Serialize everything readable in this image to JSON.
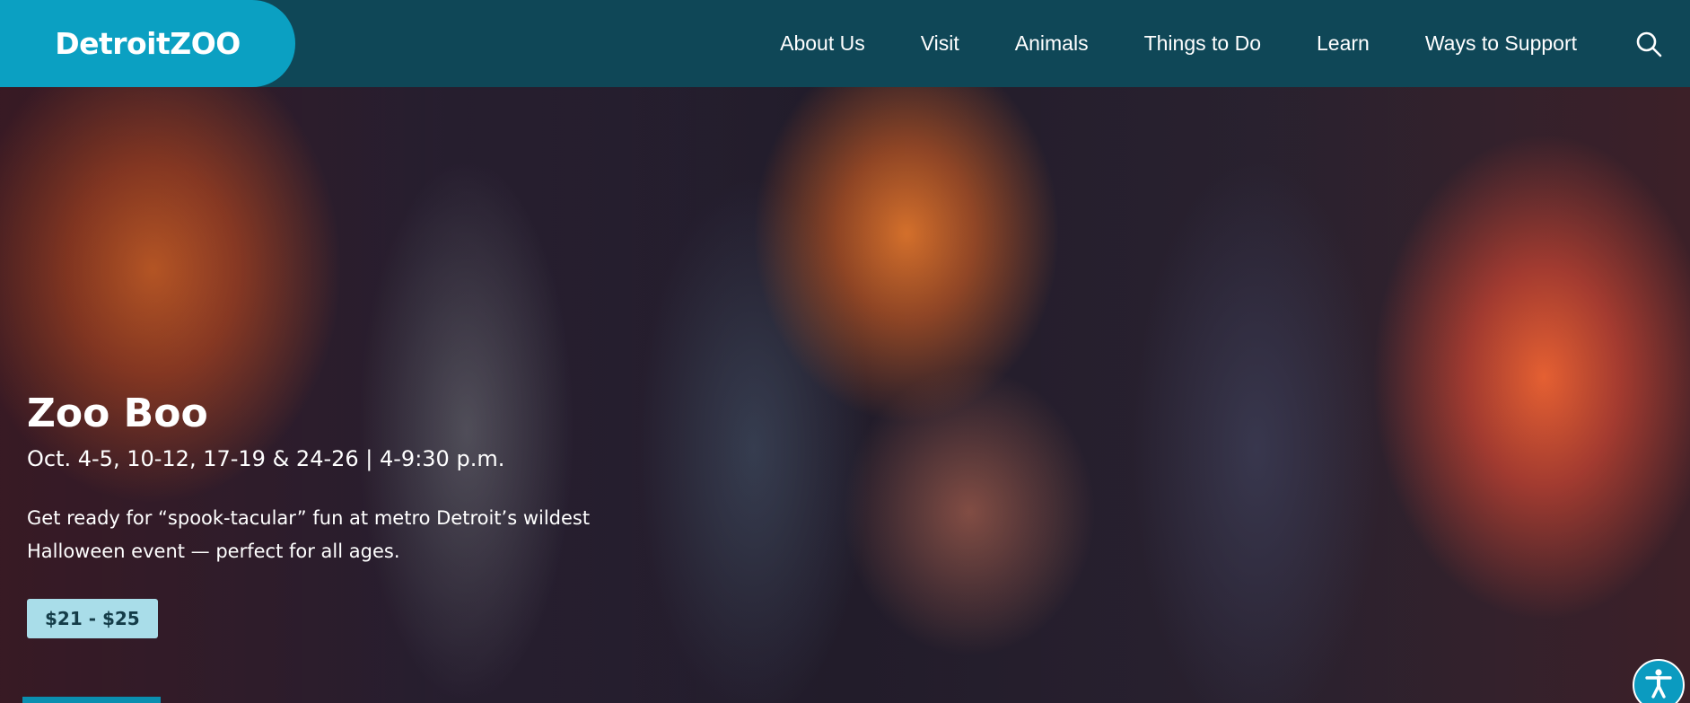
{
  "header": {
    "logo_text": "DetroitZOO",
    "nav": [
      {
        "label": "About Us"
      },
      {
        "label": "Visit"
      },
      {
        "label": "Animals"
      },
      {
        "label": "Things to Do"
      },
      {
        "label": "Learn"
      },
      {
        "label": "Ways to Support"
      }
    ],
    "search_icon": "search-icon"
  },
  "hero": {
    "title": "Zoo Boo",
    "dates": "Oct. 4-5, 10-12, 17-19 & 24-26 | 4-9:30 p.m.",
    "description": "Get ready for “spook-tacular” fun at metro Detroit’s wildest Halloween event — perfect for all ages.",
    "price": "$21 - $25"
  },
  "accessibility": {
    "icon": "accessibility-icon"
  },
  "colors": {
    "header_bg": "#0f4757",
    "logo_bg": "#0ba0c2",
    "price_badge_bg": "#a9dde9",
    "accessibility_bg": "#0b9bc0"
  }
}
